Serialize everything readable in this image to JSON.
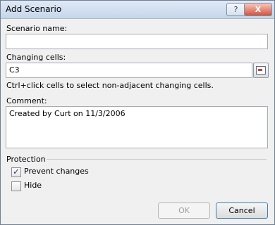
{
  "dialog": {
    "title": "Add Scenario",
    "help_glyph": "?",
    "close_glyph": "X"
  },
  "scenario_name": {
    "label": "Scenario name:",
    "value": ""
  },
  "changing_cells": {
    "label": "Changing cells:",
    "value": "C3",
    "hint": "Ctrl+click cells to select non-adjacent changing cells.",
    "range_button_icon": "collapse-range-icon"
  },
  "comment": {
    "label": "Comment:",
    "value": "Created by Curt on 11/3/2006"
  },
  "protection": {
    "title": "Protection",
    "prevent_changes": {
      "label": "Prevent changes",
      "checked": true
    },
    "hide": {
      "label": "Hide",
      "checked": false
    },
    "checkmark": "✓"
  },
  "buttons": {
    "ok": "OK",
    "cancel": "Cancel"
  }
}
